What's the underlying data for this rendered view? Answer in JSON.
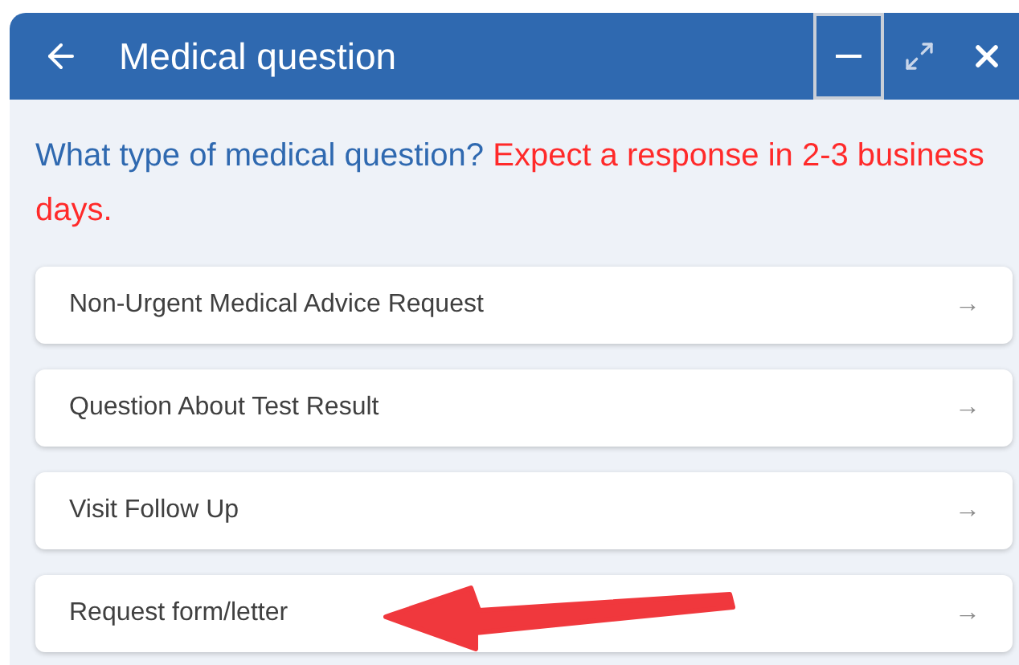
{
  "window": {
    "title": "Medical question"
  },
  "prompt": {
    "question": "What type of medical question?",
    "notice": "Expect a response in 2-3 business days."
  },
  "options": [
    {
      "label": "Non-Urgent Medical Advice Request",
      "arrow": "→"
    },
    {
      "label": "Question About Test Result",
      "arrow": "→"
    },
    {
      "label": "Visit Follow Up",
      "arrow": "→"
    },
    {
      "label": "Request form/letter",
      "arrow": "→",
      "annotated": true
    }
  ]
}
